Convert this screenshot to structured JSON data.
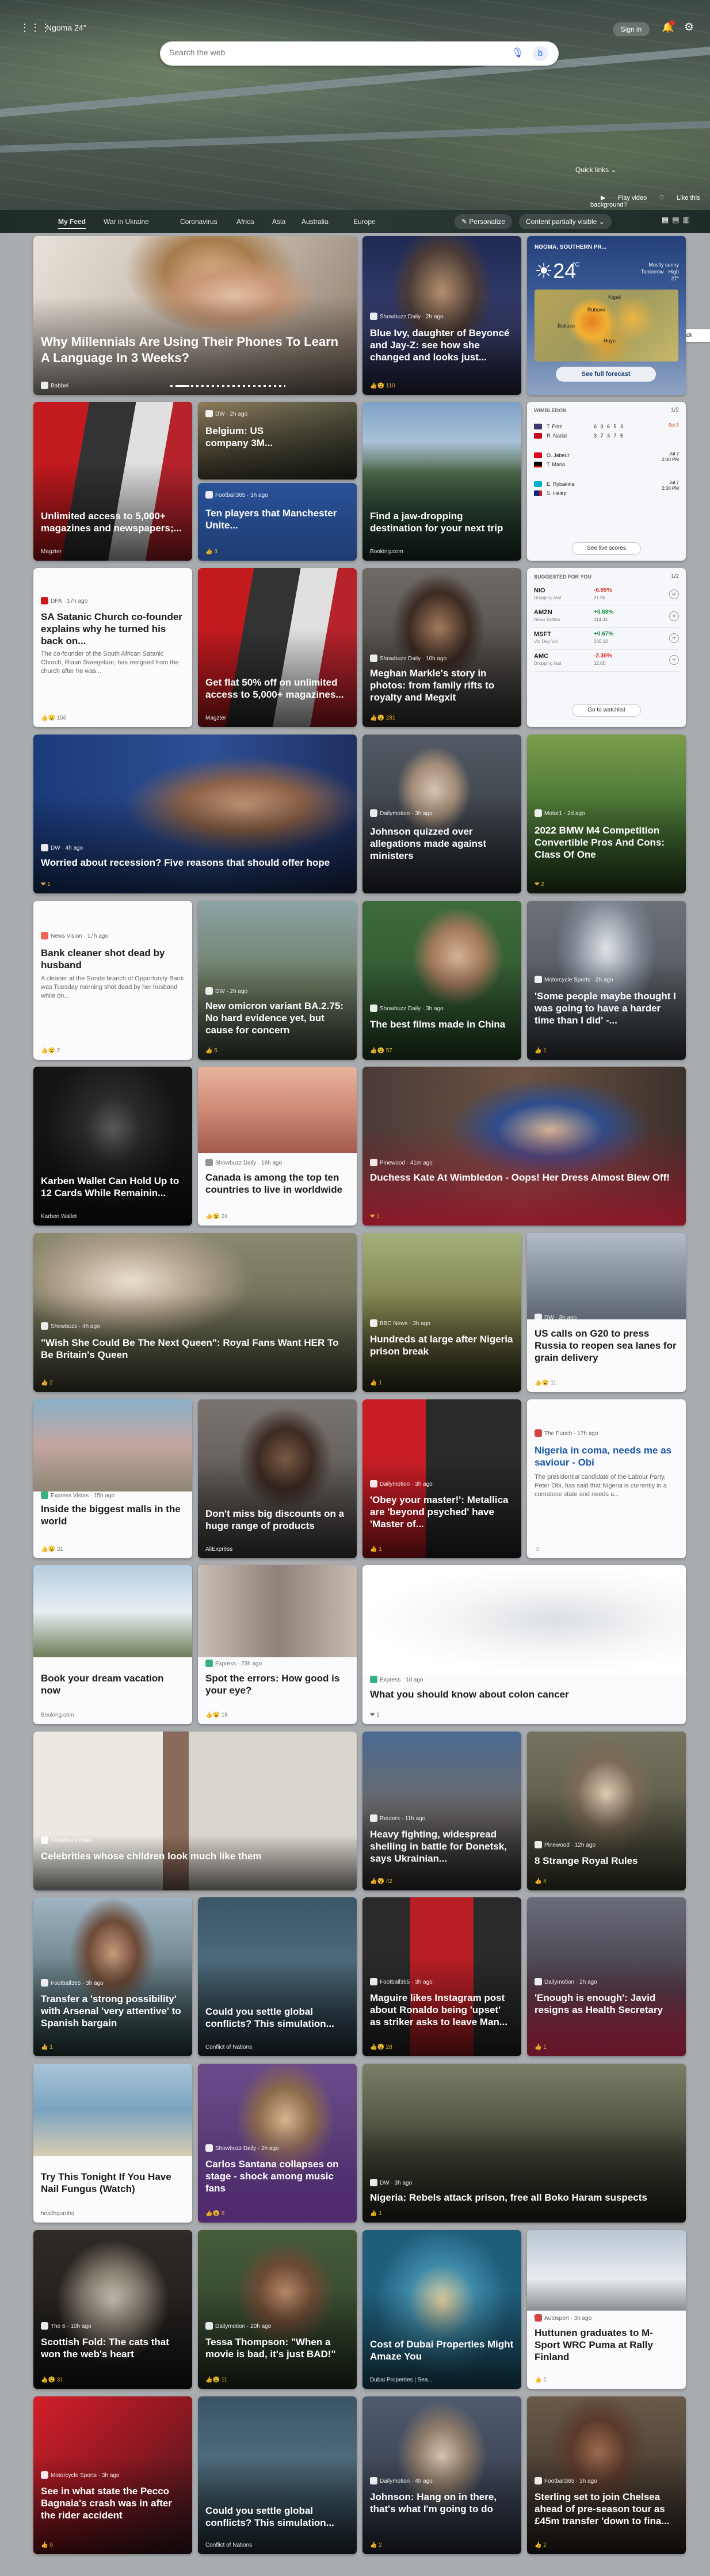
{
  "header": {
    "weather": "Ngoma 24°",
    "search_placeholder": "Search the web",
    "signin": "Sign in",
    "quick_links": "Quick links",
    "play_video": "Play video",
    "like_background": "Like this background?"
  },
  "nav": {
    "tabs": [
      "My Feed",
      "War in Ukraine",
      "Coronavirus",
      "Africa",
      "Asia",
      "Australia",
      "Europe"
    ],
    "personalize": "Personalize",
    "content": "Content partially visible"
  },
  "feedback": "Feedback",
  "weather": {
    "location": "NGOMA, SOUTHERN PR...",
    "temp": "24",
    "unit": "°C",
    "condition": "Mostly sunny",
    "temp_detail": "Tomorrow · High 27°",
    "forecast": "See full forecast",
    "cities": [
      "Kigali",
      "Bukavu",
      "Rubavu",
      "Huye"
    ]
  },
  "wimbledon": {
    "header": "WIMBLEDON",
    "pager": "1/2",
    "matches": [
      {
        "p1": "T. Fritz",
        "s1": "6 3 6 5 3",
        "p2": "R. Nadal",
        "s2": "3 7 3 7 5",
        "sub": "",
        "status": "Set 5"
      },
      {
        "p1": "O. Jabeur",
        "s1": "",
        "p2": "T. Maria",
        "s2": "",
        "sub": "",
        "status": "Jul 7\n2:00 PM"
      },
      {
        "p1": "E. Rybakina",
        "s1": "",
        "p2": "S. Halep",
        "s2": "",
        "sub": "",
        "status": "Jul 7\n2:00 PM"
      }
    ],
    "btn": "See live scores"
  },
  "stocks": {
    "header": "SUGGESTED FOR YOU",
    "pager": "1/2",
    "items": [
      {
        "ticker": "NIO",
        "co": "Dropping fast",
        "pct": "-6.89%",
        "price": "21.90"
      },
      {
        "ticker": "AMZN",
        "co": "News Button",
        "pct": "+0.68%",
        "price": "114.33"
      },
      {
        "ticker": "MSFT",
        "co": "Vid Day Vol",
        "pct": "+0.67%",
        "price": "265.12"
      },
      {
        "ticker": "AMC",
        "co": "Dropping fast",
        "pct": "-2.36%",
        "price": "12.60"
      }
    ],
    "btn": "Go to watchlist"
  },
  "cards": [
    {
      "id": "c1",
      "title": "Why Millennials Are Using Their Phones To Learn A Language In 3 Weeks?",
      "src": "Babbel",
      "meta": ""
    },
    {
      "id": "c2",
      "title": "Blue Ivy, daughter of Beyoncé and Jay-Z: see how she changed and looks just...",
      "src": "Showbuzz Daily · 2h ago",
      "meta": "110"
    },
    {
      "id": "c3",
      "title": "Unlimited access to 5,000+ magazines and newspapers;...",
      "src": "",
      "meta": "Magzter"
    },
    {
      "id": "c4a",
      "title": "Belgium: US company 3M...",
      "src": "DW · 2h ago",
      "meta": ""
    },
    {
      "id": "c4b",
      "title": "Ten players that Manchester Unite...",
      "src": "Football365 · 3h ago",
      "meta": "3"
    },
    {
      "id": "c5",
      "title": "Find a jaw-dropping destination for your next trip",
      "src": "",
      "meta": "Booking.com"
    },
    {
      "id": "c6",
      "title": "SA Satanic Church co-founder explains why he turned his back on...",
      "src": "DPA · 17h ago",
      "desc": "The co-founder of the South African Satanic Church, Riaan Swiegelaar, has resigned from the church after he was...",
      "meta": "156"
    },
    {
      "id": "c7",
      "title": "Get flat 50% off on unlimited access to 5,000+ magazines...",
      "src": "",
      "meta": "Magzter"
    },
    {
      "id": "c8",
      "title": "Meghan Markle's story in photos: from family rifts to royalty and Megxit",
      "src": "Showbuzz Daily · 10h ago",
      "meta": "281"
    },
    {
      "id": "c9",
      "title": "Worried about recession? Five reasons that should offer hope",
      "src": "DW · 4h ago",
      "meta": "1"
    },
    {
      "id": "c10",
      "title": "Johnson quizzed over allegations made against ministers",
      "src": "Dailymotion · 3h ago",
      "meta": ""
    },
    {
      "id": "c11",
      "title": "2022 BMW M4 Competition Convertible Pros And Cons: Class Of One",
      "src": "Motor1 · 2d ago",
      "meta": "2"
    },
    {
      "id": "c12",
      "title": "Bank cleaner shot dead by husband",
      "src": "News Vision · 17h ago",
      "desc": "A cleaner at the Sonde branch of Opportunity Bank was Tuesday morning shot dead by her husband while on...",
      "meta": "2"
    },
    {
      "id": "c13",
      "title": "New omicron variant BA.2.75: No hard evidence yet, but cause for concern",
      "src": "DW · 2h ago",
      "meta": "5"
    },
    {
      "id": "c14",
      "title": "The best films made in China",
      "src": "Showbuzz Daily · 3h ago",
      "meta": "57"
    },
    {
      "id": "c15",
      "title": "'Some people maybe thought I was going to have a harder time than I did' -...",
      "src": "Motorcycle Sports · 2h ago",
      "meta": "1"
    },
    {
      "id": "c16",
      "title": "Karben Wallet Can Hold Up to 12 Cards While Remainin...",
      "src": "",
      "meta": "Karben Wallet"
    },
    {
      "id": "c17",
      "title": "Canada is among the top ten countries to live in worldwide",
      "src": "Showbuzz Daily · 16h ago",
      "meta": "24"
    },
    {
      "id": "c18",
      "title": "Duchess Kate At Wimbledon - Oops! Her Dress Almost Blew Off!",
      "src": "Pinewood · 41m ago",
      "meta": "1"
    },
    {
      "id": "c19",
      "title": "\"Wish She Could Be The Next Queen\": Royal Fans Want HER To Be Britain's Queen",
      "src": "Showbuzz · 4h ago",
      "meta": "2"
    },
    {
      "id": "c20",
      "title": "Hundreds at large after Nigeria prison break",
      "src": "BBC News · 3h ago",
      "meta": "1"
    },
    {
      "id": "c21",
      "title": "US calls on G20 to press Russia to reopen sea lanes for grain delivery",
      "src": "DW · 3h ago",
      "meta": "11"
    },
    {
      "id": "c22",
      "title": "Inside the biggest malls in the world",
      "src": "Express Vistas · 15h ago",
      "meta": "31"
    },
    {
      "id": "c23",
      "title": "Don't miss big discounts on a huge range of products",
      "src": "",
      "meta": "AliExpress"
    },
    {
      "id": "c24",
      "title": "'Obey your master!': Metallica are 'beyond psyched' have 'Master of...",
      "src": "Dailymotion · 3h ago",
      "meta": "1"
    },
    {
      "id": "c25",
      "title": "Nigeria in coma, needs me as saviour - Obi",
      "src": "The Punch · 17h ago",
      "desc": "The presidential candidate of the Labour Party, Peter Obi, has said that Nigeria is currently in a comatose state and needs a...",
      "meta": ""
    },
    {
      "id": "c26",
      "title": "Book your dream vacation now",
      "src": "",
      "meta": "Booking.com"
    },
    {
      "id": "c27",
      "title": "Spot the errors: How good is your eye?",
      "src": "Express · 23h ago",
      "meta": "18"
    },
    {
      "id": "c28",
      "title": "What you should know about colon cancer",
      "src": "Express · 1d ago",
      "meta": "1"
    },
    {
      "id": "c29",
      "title": "Celebrities whose children look much like them",
      "src": "Showbuzz Daily",
      "meta": ""
    },
    {
      "id": "c30",
      "title": "Heavy fighting, widespread shelling in battle for Donetsk, says Ukrainian...",
      "src": "Reuters · 11h ago",
      "meta": "42"
    },
    {
      "id": "c31",
      "title": "8 Strange Royal Rules",
      "src": "Pinewood · 12h ago",
      "meta": "4"
    },
    {
      "id": "c32",
      "title": "Transfer a 'strong possibility' with Arsenal 'very attentive' to Spanish bargain",
      "src": "Football365 · 3h ago",
      "meta": "1"
    },
    {
      "id": "c33",
      "title": "Could you settle global conflicts? This simulation...",
      "src": "",
      "meta": "Conflict of Nations"
    },
    {
      "id": "c34",
      "title": "Maguire likes Instagram post about Ronaldo being 'upset' as striker asks to leave Man...",
      "src": "Football365 · 3h ago",
      "meta": "28"
    },
    {
      "id": "c35",
      "title": "'Enough is enough': Javid resigns as Health Secretary",
      "src": "Dailymotion · 2h ago",
      "meta": "1"
    },
    {
      "id": "c36",
      "title": "Try This Tonight If You Have Nail Fungus (Watch)",
      "src": "",
      "meta": "healthguruhq"
    },
    {
      "id": "c37",
      "title": "Carlos Santana collapses on stage - shock among music fans",
      "src": "Showbuzz Daily · 2h ago",
      "meta": "8"
    },
    {
      "id": "c38",
      "title": "Nigeria: Rebels attack prison, free all Boko Haram suspects",
      "src": "DW · 3h ago",
      "meta": "1"
    },
    {
      "id": "c39",
      "title": "Scottish Fold: The cats that won the web's heart",
      "src": "The 6 · 10h ago",
      "meta": "31"
    },
    {
      "id": "c40",
      "title": "Tessa Thompson: \"When a movie is bad, it's just BAD!\"",
      "src": "Dailymotion · 20h ago",
      "meta": "11"
    },
    {
      "id": "c41",
      "title": "Cost of Dubai Properties Might Amaze You",
      "src": "",
      "meta": "Dubai Properties | Sea..."
    },
    {
      "id": "c42",
      "title": "Huttunen graduates to M-Sport WRC Puma at Rally Finland",
      "src": "Autosport · 3h ago",
      "meta": "1"
    },
    {
      "id": "c43",
      "title": "See in what state the Pecco Bagnaia's crash was in after the rider accident",
      "src": "Motorcycle Sports · 3h ago",
      "meta": "9"
    },
    {
      "id": "c44",
      "title": "Could you settle global conflicts? This simulation...",
      "src": "",
      "meta": "Conflict of Nations"
    },
    {
      "id": "c45",
      "title": "Johnson: Hang on in there, that's what I'm going to do",
      "src": "Dailymotion · 4h ago",
      "meta": "2"
    },
    {
      "id": "c46",
      "title": "Sterling set to join Chelsea ahead of pre-season tour as £45m transfer 'down to fina...",
      "src": "Football365 · 3h ago",
      "meta": "2"
    }
  ]
}
